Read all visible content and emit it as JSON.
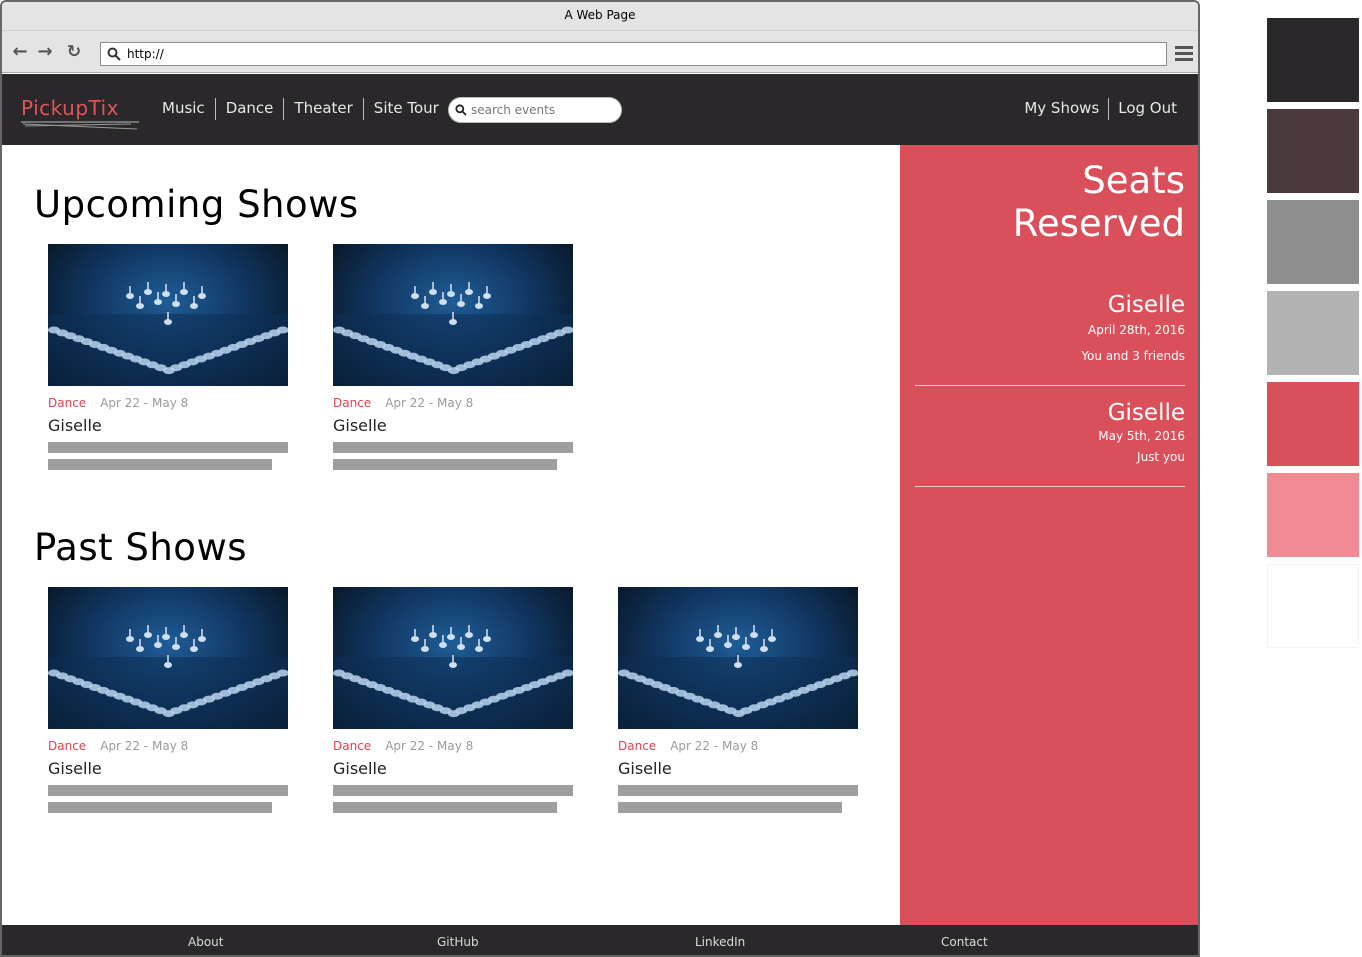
{
  "browser": {
    "title": "A Web Page",
    "url": "http://"
  },
  "site": {
    "logo": "PickupTix",
    "nav": [
      "Music",
      "Dance",
      "Theater",
      "Site Tour"
    ],
    "search_placeholder": "search events",
    "user_nav": [
      "My Shows",
      "Log Out"
    ]
  },
  "upcoming": {
    "heading": "Upcoming Shows",
    "cards": [
      {
        "category": "Dance",
        "dates": "Apr 22 - May 8",
        "title": "Giselle"
      },
      {
        "category": "Dance",
        "dates": "Apr 22 - May 8",
        "title": "Giselle"
      }
    ]
  },
  "past": {
    "heading": "Past Shows",
    "cards": [
      {
        "category": "Dance",
        "dates": "Apr 22 - May 8",
        "title": "Giselle"
      },
      {
        "category": "Dance",
        "dates": "Apr 22 - May 8",
        "title": "Giselle"
      },
      {
        "category": "Dance",
        "dates": "Apr 22 - May 8",
        "title": "Giselle"
      }
    ]
  },
  "sidebar": {
    "title": "Seats Reserved",
    "reservations": [
      {
        "show": "Giselle",
        "date": "April 28th, 2016",
        "who": "You and 3 friends"
      },
      {
        "show": "Giselle",
        "date": "May 5th, 2016",
        "who": "Just you"
      }
    ]
  },
  "footer": {
    "links": [
      "About",
      "GitHub",
      "LinkedIn",
      "Contact"
    ]
  },
  "palette": [
    "#2a282a",
    "#4b3a3b",
    "#8e8e8e",
    "#b3b3b3",
    "#d9505b",
    "#f08a93",
    "#ffffff"
  ]
}
